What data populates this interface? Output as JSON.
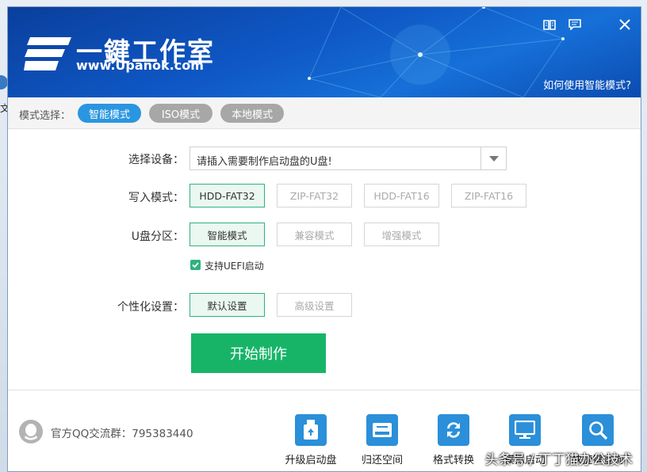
{
  "background": {
    "letter": "文"
  },
  "header": {
    "brand": "一鍵工作室",
    "site": "www.Upanok.com",
    "help_link": "如何使用智能模式?"
  },
  "mode_bar": {
    "label": "模式选择：",
    "modes": [
      {
        "label": "智能模式",
        "active": true
      },
      {
        "label": "ISO模式",
        "active": false
      },
      {
        "label": "本地模式",
        "active": false
      }
    ]
  },
  "form": {
    "device_label": "选择设备：",
    "device_value": "请插入需要制作启动盘的U盘!",
    "write_mode_label": "写入模式：",
    "write_modes": [
      "HDD-FAT32",
      "ZIP-FAT32",
      "HDD-FAT16",
      "ZIP-FAT16"
    ],
    "partition_label": "U盘分区：",
    "partition_modes": [
      "智能模式",
      "兼容模式",
      "增强模式"
    ],
    "uefi_label": "支持UEFI启动",
    "personal_label": "个性化设置：",
    "personal_options": [
      "默认设置",
      "高级设置"
    ],
    "start_button": "开始制作"
  },
  "footer": {
    "qq_text": "官方QQ交流群：795383440",
    "tools": [
      "升级启动盘",
      "归还空间",
      "格式转换",
      "模拟启动",
      "快捷键查询"
    ]
  },
  "watermark": "头条号 / 丁丁猫办公技术",
  "colors": {
    "accent": "#2a95e0",
    "green": "#17b468",
    "selected_border": "#2fb37e"
  }
}
